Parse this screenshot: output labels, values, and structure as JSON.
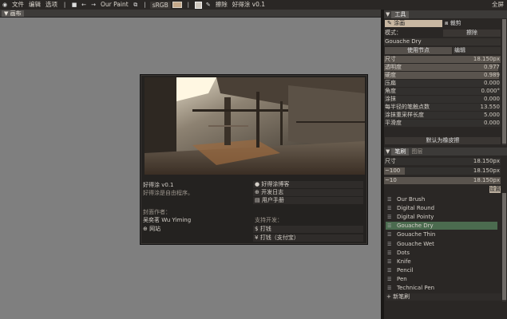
{
  "menubar": {
    "file": "文件",
    "edit": "编辑",
    "options": "选项",
    "undo_icon": "undo-icon",
    "redo_icon": "redo-icon",
    "app_name": "Our Paint",
    "colorspace": "sRGB",
    "erase_label": "擦除",
    "title": "好得涂 v0.1",
    "fullscreen": "全屏",
    "accent_color": "#c5a98a"
  },
  "canvas_panel": {
    "tab": "画布"
  },
  "splash": {
    "title": "好得涂 v0.1",
    "subtitle": "好得涂是自由程序。",
    "cover_author_label": "封面作者：",
    "cover_author": "吴奕茗 Wu Yiming",
    "website": "网站",
    "links": [
      "好得涂博客",
      "开发日志",
      "用户手册"
    ],
    "support_label": "支持开发：",
    "donations": [
      "打钱",
      "打钱（支付宝）"
    ]
  },
  "tools_panel": {
    "tab": "工具",
    "tool_paint": "涂画",
    "tool_crop": "裁剪",
    "mode_label": "模式：",
    "mode_value": "擦除",
    "brush_name": "Gouache Dry",
    "use_nodes": "使用节点",
    "edit": "编辑",
    "params": [
      {
        "label": "尺寸",
        "value": "18.150px",
        "fill": 1.0
      },
      {
        "label": "透明度",
        "value": "0.977",
        "fill": 0.977
      },
      {
        "label": "硬度",
        "value": "0.989",
        "fill": 0.989
      },
      {
        "label": "压扁",
        "value": "0.000",
        "fill": 0
      },
      {
        "label": "角度",
        "value": "0.000°",
        "fill": 0
      },
      {
        "label": "涂抹",
        "value": "0.000",
        "fill": 0
      },
      {
        "label": "每半径的笔触点数",
        "value": "13.550",
        "fill": 0
      },
      {
        "label": "涂抹重采样长度",
        "value": "5.000",
        "fill": 0
      },
      {
        "label": "平滑度",
        "value": "0.000",
        "fill": 0
      }
    ],
    "default_eraser": "默认为橡皮擦"
  },
  "brush_panel": {
    "tab": "笔刷",
    "tab2": "图层",
    "size_rows": [
      {
        "label": "尺寸",
        "value": "18.150px"
      },
      {
        "label": "~100",
        "value": "18.150px"
      },
      {
        "label": "~10",
        "value": "18.150px"
      }
    ],
    "apply": "设置",
    "brushes": [
      "Our Brush",
      "Digital Round",
      "Digital Pointy",
      "Gouache Dry",
      "Gouache Thin",
      "Gouache Wet",
      "Dots",
      "Knife",
      "Pencil",
      "Pen",
      "Technical Pen"
    ],
    "active_brush": "Gouache Dry",
    "new_brush": "新笔刷",
    "active_color": "#4b6b4f"
  }
}
